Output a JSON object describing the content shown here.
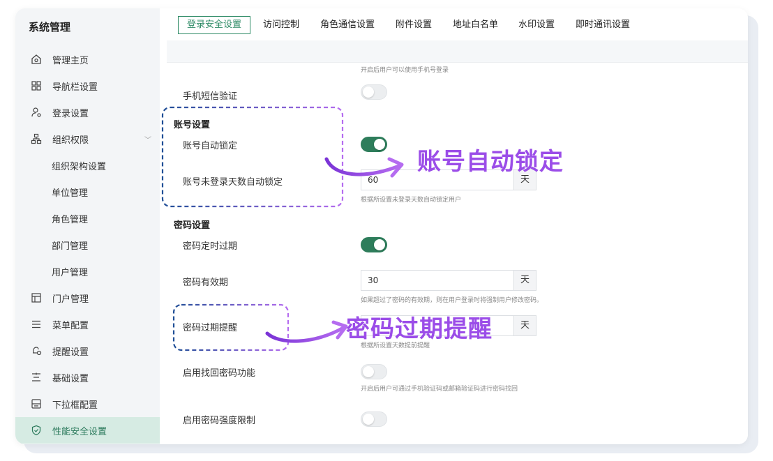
{
  "sidebar": {
    "title": "系统管理",
    "items": [
      {
        "label": "管理主页",
        "icon": "home-icon"
      },
      {
        "label": "导航栏设置",
        "icon": "grid-icon"
      },
      {
        "label": "登录设置",
        "icon": "user-login-icon"
      },
      {
        "label": "组织权限",
        "icon": "org-tree-icon"
      },
      {
        "label": "组织架构设置"
      },
      {
        "label": "单位管理"
      },
      {
        "label": "角色管理"
      },
      {
        "label": "部门管理"
      },
      {
        "label": "用户管理"
      },
      {
        "label": "门户管理",
        "icon": "portal-icon"
      },
      {
        "label": "菜单配置",
        "icon": "menu-lines-icon"
      },
      {
        "label": "提醒设置",
        "icon": "bell-icon"
      },
      {
        "label": "基础设置",
        "icon": "sliders-icon"
      },
      {
        "label": "下拉框配置",
        "icon": "dropdown-box-icon"
      },
      {
        "label": "性能安全设置",
        "icon": "shield-icon"
      }
    ]
  },
  "tabs": [
    "登录安全设置",
    "访问控制",
    "角色通信设置",
    "附件设置",
    "地址白名单",
    "水印设置",
    "即时通讯设置"
  ],
  "content": {
    "top_hint": "开启后用户可以使用手机号登录",
    "sms_label": "手机短信验证",
    "account_section": "账号设置",
    "auto_lock_label": "账号自动锁定",
    "inactive_lock_label": "账号未登录天数自动锁定",
    "inactive_days": "60",
    "unit_day": "天",
    "inactive_hint": "根据所设置未登录天数自动锁定用户",
    "password_section": "密码设置",
    "pwd_expire_label": "密码定时过期",
    "pwd_valid_label": "密码有效期",
    "pwd_valid_days": "30",
    "pwd_valid_hint": "如果超过了密码的有效期，则在用户登录时将强制用户修改密码。",
    "pwd_remind_label": "密码过期提醒",
    "pwd_remind_hint": "根据所设置天数提前提醒",
    "recover_label": "启用找回密码功能",
    "recover_hint": "开启后用户可通过手机验证码或邮箱验证码进行密码找回",
    "strength_label": "启用密码强度限制"
  },
  "toggles": {
    "sms": "off",
    "auto_lock": "on",
    "pwd_expire": "on",
    "recover": "off",
    "strength": "off"
  },
  "callouts": {
    "auto_lock": "账号自动锁定",
    "pwd_remind": "密码过期提醒"
  },
  "colors": {
    "accent": "#2e7d5b",
    "callout": "#9b4de8",
    "dash_blue": "#1f4e96",
    "dash_purple": "#b56cf0"
  }
}
